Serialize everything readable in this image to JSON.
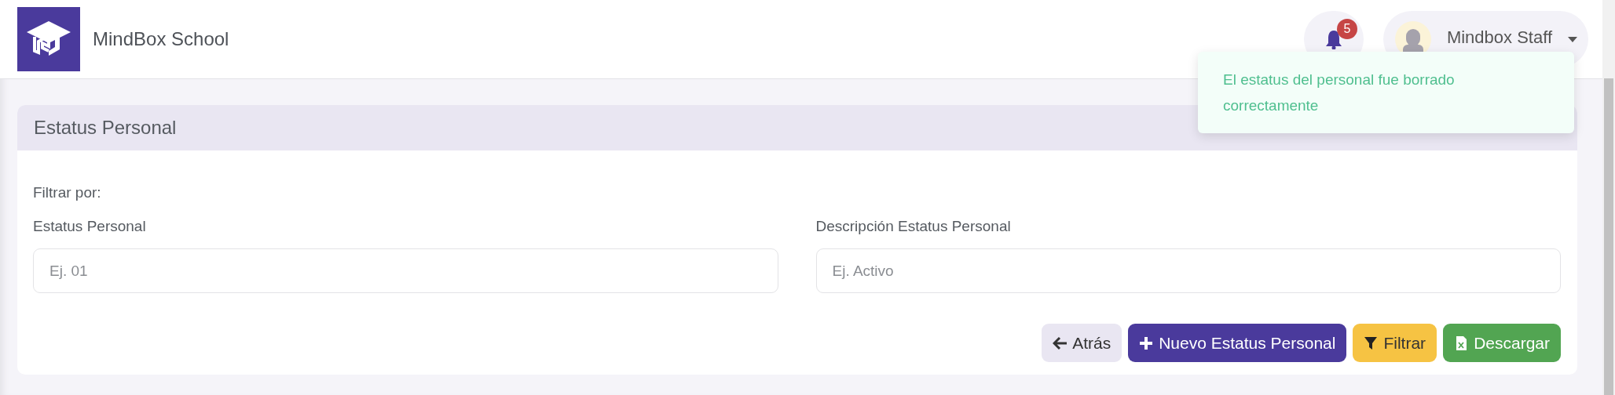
{
  "brand": {
    "title": "MindBox School"
  },
  "notifications": {
    "count": "5"
  },
  "user": {
    "name": "Mindbox Staff"
  },
  "toast": {
    "message": "El estatus del personal fue borrado correctamente"
  },
  "card": {
    "title": "Estatus Personal",
    "filter_label": "Filtrar por:",
    "fields": [
      {
        "label": "Estatus Personal",
        "placeholder": "Ej. 01"
      },
      {
        "label": "Descripción Estatus Personal",
        "placeholder": "Ej. Activo"
      }
    ],
    "buttons": [
      {
        "kind": "back",
        "label": "Atrás"
      },
      {
        "kind": "new",
        "label": "Nuevo Estatus Personal"
      },
      {
        "kind": "filter",
        "label": "Filtrar"
      },
      {
        "kind": "download",
        "label": "Descargar"
      }
    ]
  }
}
